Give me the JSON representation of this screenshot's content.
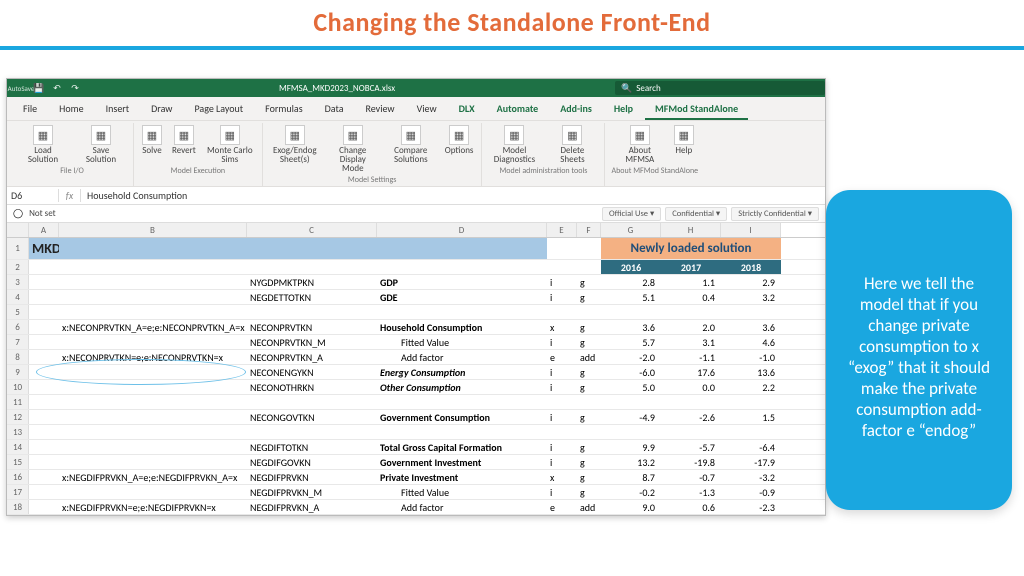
{
  "slide": {
    "title": "Changing the Standalone Front-End"
  },
  "titlebar": {
    "autosave": "AutoSave",
    "off": "Off",
    "filename": "MFMSA_MKD2023_NOBCA.xlsx",
    "search": "Search"
  },
  "tabs": [
    "File",
    "Home",
    "Insert",
    "Draw",
    "Page Layout",
    "Formulas",
    "Data",
    "Review",
    "View",
    "DLX",
    "Automate",
    "Add-ins",
    "Help",
    "MFMod StandAlone"
  ],
  "ribbon_groups": {
    "fileio": {
      "label": "File I/O",
      "items": [
        "Load Solution",
        "Save Solution"
      ]
    },
    "exec": {
      "label": "Model Execution",
      "items": [
        "Solve",
        "Revert",
        "Monte Carlo Sims"
      ]
    },
    "settings": {
      "label": "Model Settings",
      "items": [
        "Exog/Endog Sheet(s)",
        "Change Display Mode",
        "Compare Solutions",
        "Options"
      ]
    },
    "admin": {
      "label": "Model administration tools",
      "items": [
        "Model Diagnostics",
        "Delete Sheets"
      ]
    },
    "about": {
      "label": "About MFMod StandAlone",
      "items": [
        "About MFMSA",
        "Help"
      ]
    }
  },
  "formula": {
    "cell": "D6",
    "fx": "fx",
    "value": "Household Consumption"
  },
  "classification": {
    "notset": "Not set",
    "pills": [
      "Official Use",
      "Confidential",
      "Strictly Confidential"
    ]
  },
  "cols": [
    "",
    "A",
    "B",
    "C",
    "D",
    "E",
    "F",
    "G",
    "H",
    "I"
  ],
  "mkd": "MKD",
  "newly_loaded": "Newly loaded solution",
  "years": [
    "2016",
    "2017",
    "2018"
  ],
  "rows": [
    {
      "n": "3",
      "B": "",
      "C": "NYGDPMKTPKN",
      "D": "GDP",
      "Db": true,
      "E": "i",
      "F": "g",
      "G": "2.8",
      "H": "1.1",
      "I": "2.9"
    },
    {
      "n": "4",
      "B": "",
      "C": "NEGDETTOTKN",
      "D": "GDE",
      "Db": true,
      "E": "i",
      "F": "g",
      "G": "5.1",
      "H": "0.4",
      "I": "3.2"
    },
    {
      "n": "5",
      "B": "",
      "C": "",
      "D": "",
      "E": "",
      "F": "",
      "G": "",
      "H": "",
      "I": ""
    },
    {
      "n": "6",
      "B": "x:NECONPRVTKN_A=e;e:NECONPRVTKN_A=x",
      "C": "NECONPRVTKN",
      "D": "Household Consumption",
      "Db": true,
      "E": "x",
      "F": "g",
      "G": "3.6",
      "H": "2.0",
      "I": "3.6"
    },
    {
      "n": "7",
      "B": "",
      "C": "NECONPRVTKN_M",
      "D": "Fitted Value",
      "E": "i",
      "F": "g",
      "G": "5.7",
      "H": "3.1",
      "I": "4.6"
    },
    {
      "n": "8",
      "B": "x:NECONPRVTKN=e;e:NECONPRVTKN=x",
      "C": "NECONPRVTKN_A",
      "D": "Add factor",
      "E": "e",
      "F": "add",
      "G": "-2.0",
      "H": "-1.1",
      "I": "-1.0"
    },
    {
      "n": "9",
      "B": "",
      "C": "NECONENGYKN",
      "D": "Energy Consumption",
      "Db": true,
      "Di": true,
      "E": "i",
      "F": "g",
      "G": "-6.0",
      "H": "17.6",
      "I": "13.6"
    },
    {
      "n": "10",
      "B": "",
      "C": "NECONOTHRKN",
      "D": "Other Consumption",
      "Db": true,
      "Di": true,
      "E": "i",
      "F": "g",
      "G": "5.0",
      "H": "0.0",
      "I": "2.2"
    },
    {
      "n": "11",
      "B": "",
      "C": "",
      "D": "",
      "E": "",
      "F": "",
      "G": "",
      "H": "",
      "I": ""
    },
    {
      "n": "12",
      "B": "",
      "C": "NECONGOVTKN",
      "D": "Government Consumption",
      "Db": true,
      "E": "i",
      "F": "g",
      "G": "-4.9",
      "H": "-2.6",
      "I": "1.5"
    },
    {
      "n": "13",
      "B": "",
      "C": "",
      "D": "",
      "E": "",
      "F": "",
      "G": "",
      "H": "",
      "I": ""
    },
    {
      "n": "14",
      "B": "",
      "C": "NEGDIFTOTKN",
      "D": "Total Gross Capital Formation",
      "Db": true,
      "E": "i",
      "F": "g",
      "G": "9.9",
      "H": "-5.7",
      "I": "-6.4"
    },
    {
      "n": "15",
      "B": "",
      "C": "NEGDIFGOVKN",
      "D": "Government Investment",
      "Db": true,
      "E": "i",
      "F": "g",
      "G": "13.2",
      "H": "-19.8",
      "I": "-17.9"
    },
    {
      "n": "16",
      "B": "x:NEGDIFPRVKN_A=e;e:NEGDIFPRVKN_A=x",
      "C": "NEGDIFPRVKN",
      "D": "Private Investment",
      "Db": true,
      "E": "x",
      "F": "g",
      "G": "8.7",
      "H": "-0.7",
      "I": "-3.2"
    },
    {
      "n": "17",
      "B": "",
      "C": "NEGDIFPRVKN_M",
      "D": "Fitted Value",
      "E": "i",
      "F": "g",
      "G": "-0.2",
      "H": "-1.3",
      "I": "-0.9"
    },
    {
      "n": "18",
      "B": "x:NEGDIFPRVKN=e;e:NEGDIFPRVKN=x",
      "C": "NEGDIFPRVKN_A",
      "D": "Add factor",
      "E": "e",
      "F": "add",
      "G": "9.0",
      "H": "0.6",
      "I": "-2.3"
    }
  ],
  "callout": "Here we tell the model that if you change private consumption to x “exog” that it should make the private consumption add-factor e “endog”"
}
